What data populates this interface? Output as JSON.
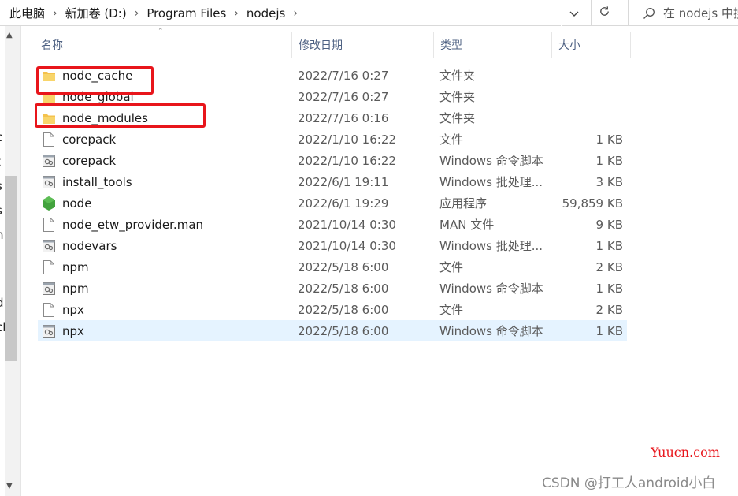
{
  "address_bar": {
    "crumbs": [
      "此电脑",
      "新加卷 (D:)",
      "Program Files",
      "nodejs"
    ],
    "search_placeholder": "在 nodejs 中搜索"
  },
  "columns": {
    "name": "名称",
    "date": "修改日期",
    "type": "类型",
    "size": "大小"
  },
  "files": [
    {
      "name": "node_cache",
      "date": "2022/7/16 0:27",
      "type": "文件夹",
      "size": "",
      "icon": "folder-icon"
    },
    {
      "name": "node_global",
      "date": "2022/7/16 0:27",
      "type": "文件夹",
      "size": "",
      "icon": "folder-icon"
    },
    {
      "name": "node_modules",
      "date": "2022/7/16 0:16",
      "type": "文件夹",
      "size": "",
      "icon": "folder-icon"
    },
    {
      "name": "corepack",
      "date": "2022/1/10 16:22",
      "type": "文件",
      "size": "1 KB",
      "icon": "file-icon"
    },
    {
      "name": "corepack",
      "date": "2022/1/10 16:22",
      "type": "Windows 命令脚本",
      "size": "1 KB",
      "icon": "script-icon"
    },
    {
      "name": "install_tools",
      "date": "2022/6/1 19:11",
      "type": "Windows 批处理...",
      "size": "3 KB",
      "icon": "script-icon"
    },
    {
      "name": "node",
      "date": "2022/6/1 19:29",
      "type": "应用程序",
      "size": "59,859 KB",
      "icon": "node-app-icon"
    },
    {
      "name": "node_etw_provider.man",
      "date": "2021/10/14 0:30",
      "type": "MAN 文件",
      "size": "9 KB",
      "icon": "file-icon"
    },
    {
      "name": "nodevars",
      "date": "2021/10/14 0:30",
      "type": "Windows 批处理...",
      "size": "1 KB",
      "icon": "script-icon"
    },
    {
      "name": "npm",
      "date": "2022/5/18 6:00",
      "type": "文件",
      "size": "2 KB",
      "icon": "file-icon"
    },
    {
      "name": "npm",
      "date": "2022/5/18 6:00",
      "type": "Windows 命令脚本",
      "size": "1 KB",
      "icon": "script-icon"
    },
    {
      "name": "npx",
      "date": "2022/5/18 6:00",
      "type": "文件",
      "size": "2 KB",
      "icon": "file-icon"
    },
    {
      "name": "npx",
      "date": "2022/5/18 6:00",
      "type": "Windows 命令脚本",
      "size": "1 KB",
      "icon": "script-icon"
    }
  ],
  "selected_index": 12,
  "left_pane_fragments": [
    "(",
    "c",
    "t",
    "s",
    "s",
    "n",
    "d",
    "cl"
  ],
  "watermarks": {
    "site": "Yuucn.com",
    "author": "CSDN @打工人android小白"
  },
  "colors": {
    "highlight_box": "#e8151b",
    "selection": "#e5f3ff",
    "folder": "#f4c24d",
    "node_green": "#43a33e"
  }
}
